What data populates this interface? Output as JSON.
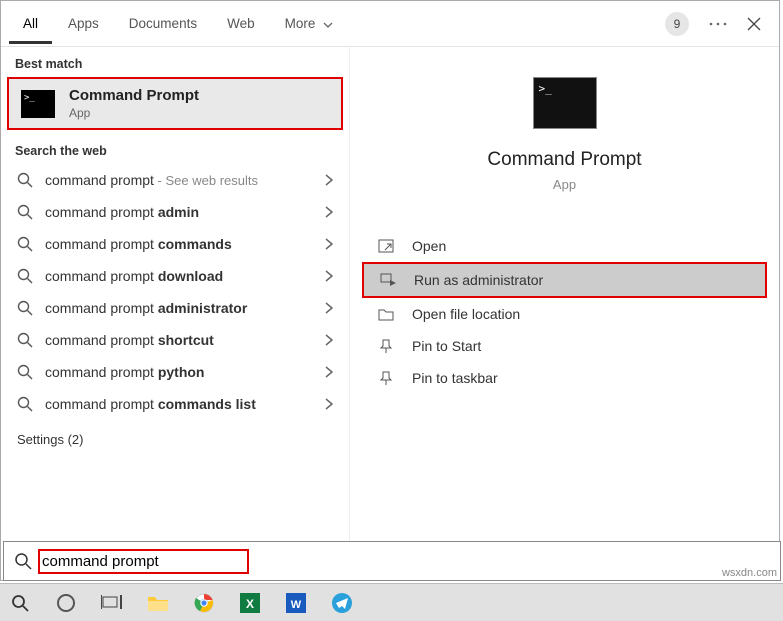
{
  "topbar": {
    "tabs": [
      {
        "label": "All",
        "active": true
      },
      {
        "label": "Apps",
        "active": false
      },
      {
        "label": "Documents",
        "active": false
      },
      {
        "label": "Web",
        "active": false
      },
      {
        "label": "More",
        "active": false
      }
    ],
    "count": "9"
  },
  "left": {
    "best_match_header": "Best match",
    "best_match": {
      "title": "Command Prompt",
      "sub": "App"
    },
    "web_header": "Search the web",
    "web_items": [
      {
        "prefix": "command prompt",
        "bold": "",
        "hint": " - See web results"
      },
      {
        "prefix": "command prompt ",
        "bold": "admin",
        "hint": ""
      },
      {
        "prefix": "command prompt ",
        "bold": "commands",
        "hint": ""
      },
      {
        "prefix": "command prompt ",
        "bold": "download",
        "hint": ""
      },
      {
        "prefix": "command prompt ",
        "bold": "administrator",
        "hint": ""
      },
      {
        "prefix": "command prompt ",
        "bold": "shortcut",
        "hint": ""
      },
      {
        "prefix": "command prompt ",
        "bold": "python",
        "hint": ""
      },
      {
        "prefix": "command prompt ",
        "bold": "commands list",
        "hint": ""
      }
    ],
    "settings": "Settings (2)"
  },
  "right": {
    "title": "Command Prompt",
    "sub": "App",
    "actions": [
      {
        "label": "Open",
        "icon": "open",
        "highlight": false
      },
      {
        "label": "Run as administrator",
        "icon": "admin",
        "highlight": true
      },
      {
        "label": "Open file location",
        "icon": "folder",
        "highlight": false
      },
      {
        "label": "Pin to Start",
        "icon": "pin",
        "highlight": false
      },
      {
        "label": "Pin to taskbar",
        "icon": "pin",
        "highlight": false
      }
    ]
  },
  "search": {
    "value": "command prompt"
  },
  "watermark": "wsxdn.com"
}
